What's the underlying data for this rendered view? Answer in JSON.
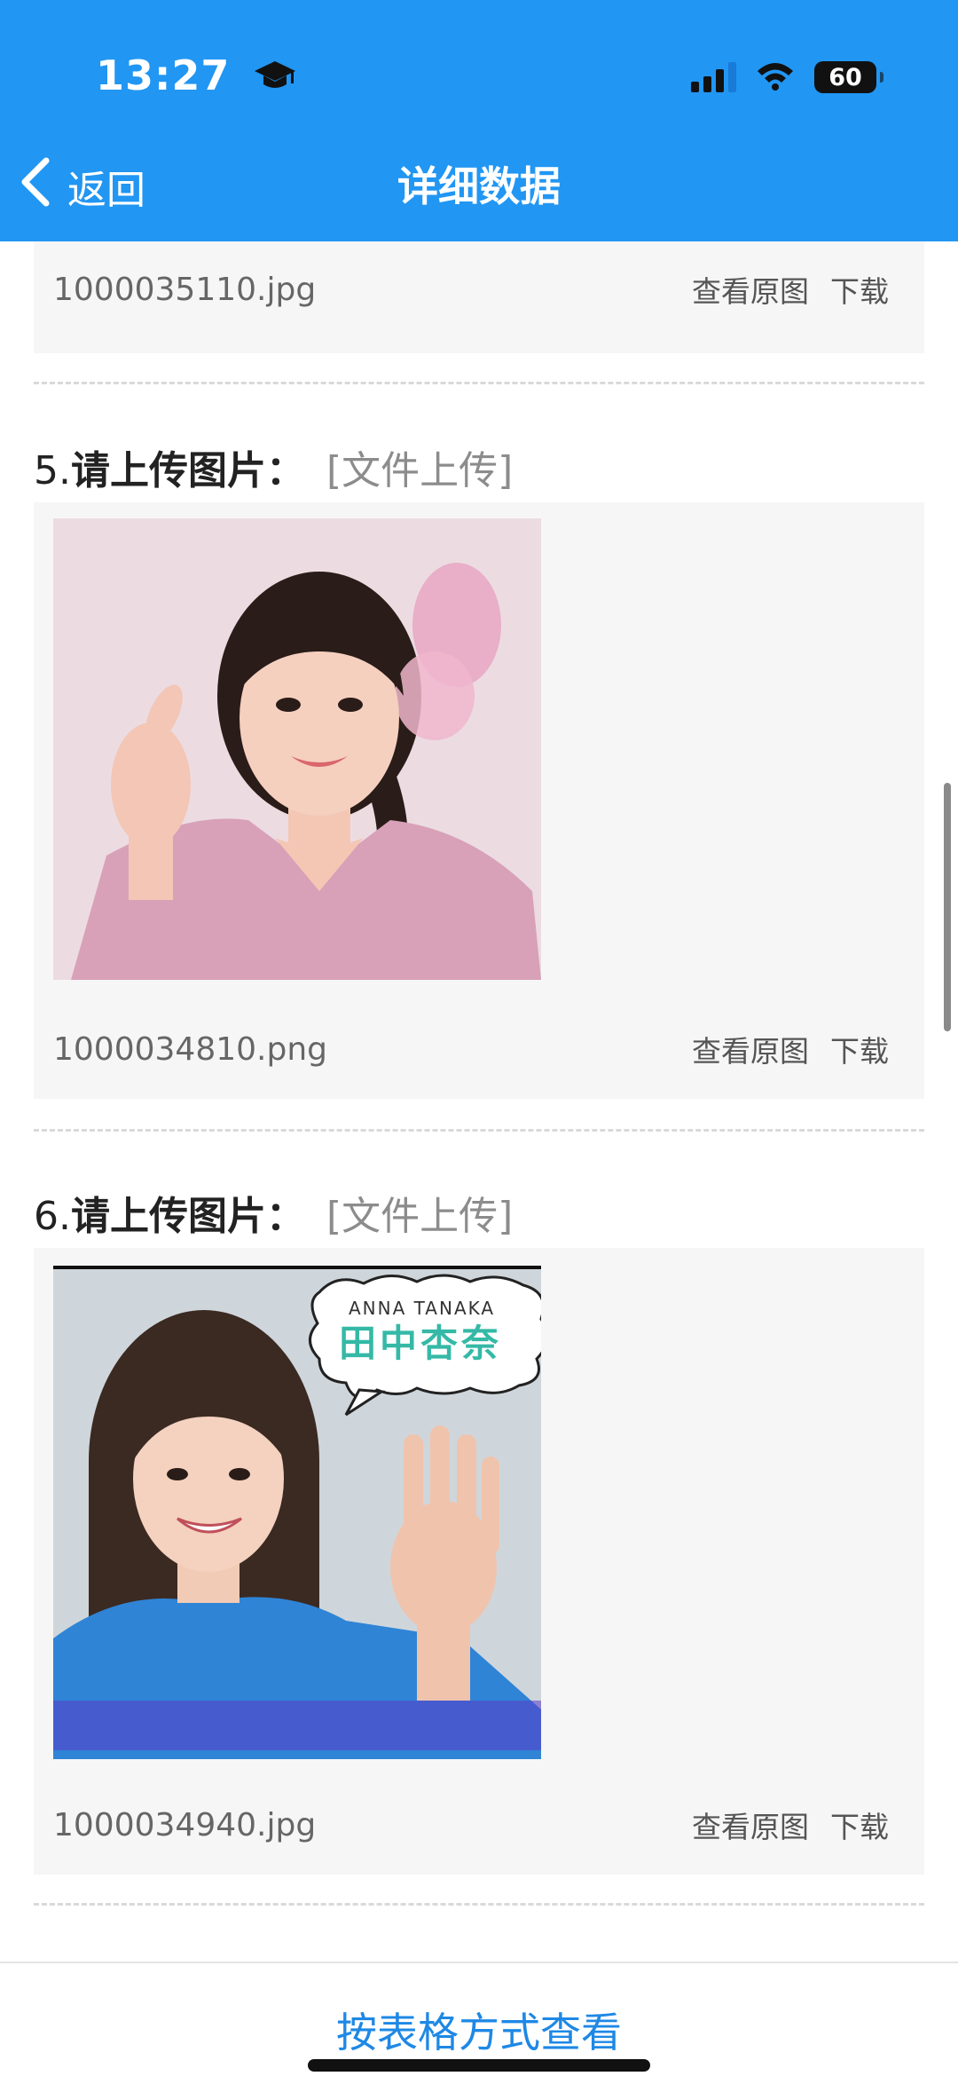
{
  "status_bar": {
    "time": "13:27",
    "battery": "60",
    "battery_level_percent": 60,
    "icons": [
      "graduation-cap-icon",
      "cellular-signal-icon",
      "wifi-icon",
      "battery-icon"
    ]
  },
  "nav": {
    "back_label": "返回",
    "title": "详细数据"
  },
  "entries": [
    {
      "file_name": "1000035110.jpg",
      "actions": {
        "view_original": "查看原图",
        "download": "下载"
      }
    },
    {
      "number": "5.",
      "label": "请上传图片：",
      "type": "[文件上传]",
      "file_name": "1000034810.png",
      "actions": {
        "view_original": "查看原图",
        "download": "下载"
      }
    },
    {
      "number": "6.",
      "label": "请上传图片：",
      "type": "[文件上传]",
      "bubble_caption_top": "ANNA TANAKA",
      "bubble_caption_main": "田中杏奈",
      "file_name": "1000034940.jpg",
      "actions": {
        "view_original": "查看原图",
        "download": "下载"
      }
    }
  ],
  "bottom": {
    "table_view_label": "按表格方式查看"
  },
  "colors": {
    "header_bg": "#2196f3",
    "link_blue": "#1e88e5",
    "card_bg": "#f6f6f6"
  }
}
